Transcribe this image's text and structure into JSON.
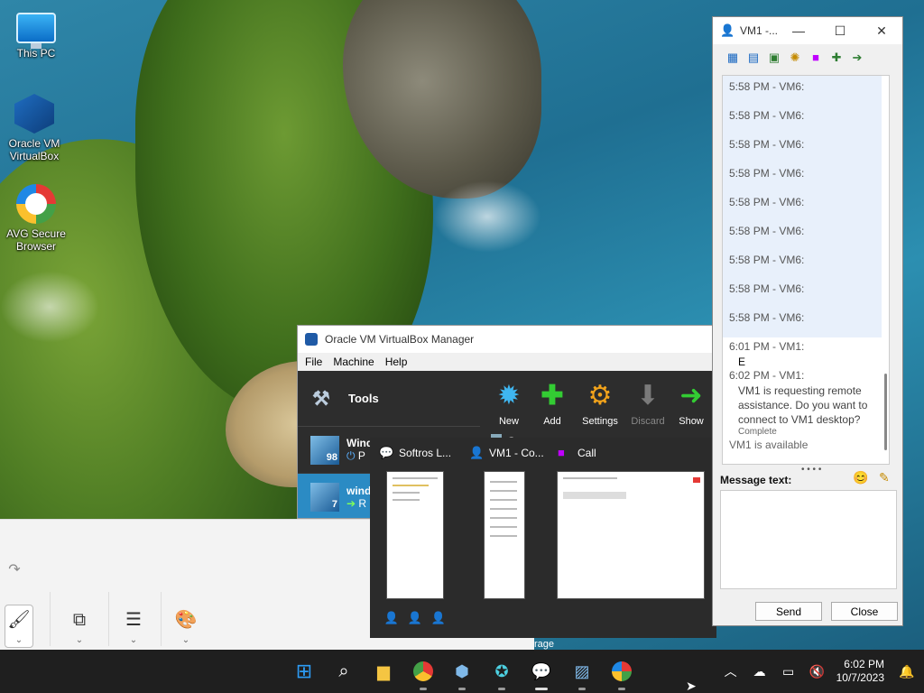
{
  "desktop": {
    "icons": [
      {
        "label": "This PC"
      },
      {
        "label": "Oracle VM VirtualBox"
      },
      {
        "label": "AVG Secure Browser"
      }
    ]
  },
  "vbox": {
    "title": "Oracle VM VirtualBox Manager",
    "menu": [
      "File",
      "Machine",
      "Help"
    ],
    "tools_label": "Tools",
    "toolbar": [
      {
        "label": "New",
        "icon": "starburst-icon",
        "color": "#3fb6f0"
      },
      {
        "label": "Add",
        "icon": "plus-icon",
        "color": "#33cc33"
      },
      {
        "label": "Settings",
        "icon": "gear-icon",
        "color": "#f2a31b"
      },
      {
        "label": "Discard",
        "icon": "down-arrow-icon",
        "color": "#7a7a7a"
      },
      {
        "label": "Show",
        "icon": "right-arrow-icon",
        "color": "#33cc33"
      }
    ],
    "vms": [
      {
        "name": "Wind",
        "badge": "98",
        "status": "P"
      },
      {
        "name": "wind",
        "badge": "7",
        "status": "R"
      }
    ],
    "partial_label": "G"
  },
  "preview": {
    "items": [
      {
        "title": "Softros L..."
      },
      {
        "title": "VM1 - Co..."
      },
      {
        "title": "Call"
      }
    ]
  },
  "chat": {
    "title": "VM1 -...",
    "messages_vm6": [
      "5:58 PM - VM6:",
      "5:58 PM - VM6:",
      "5:58 PM - VM6:",
      "5:58 PM - VM6:",
      "5:58 PM - VM6:",
      "5:58 PM - VM6:",
      "5:58 PM - VM6:",
      "5:58 PM - VM6:",
      "5:58 PM - VM6:"
    ],
    "msg1_time": "6:01 PM - VM1:",
    "msg1_body": "E",
    "msg2_time": "6:02 PM - VM1:",
    "msg2_body": "VM1 is requesting remote assistance. Do you want to connect to VM1 desktop?",
    "msg2_status": "Complete",
    "availability": "VM1 is available",
    "message_label": "Message text:",
    "message_value": "",
    "send_label": "Send",
    "close_label": "Close"
  },
  "bg_app": {
    "partial_text": "rage"
  },
  "taskbar": {
    "time": "6:02 PM",
    "date": "10/7/2023"
  },
  "colors": {
    "taskbar": "#1f1f1f",
    "vbox_selected": "#2b8bc4",
    "chat_highlight": "#e8f0fb"
  }
}
